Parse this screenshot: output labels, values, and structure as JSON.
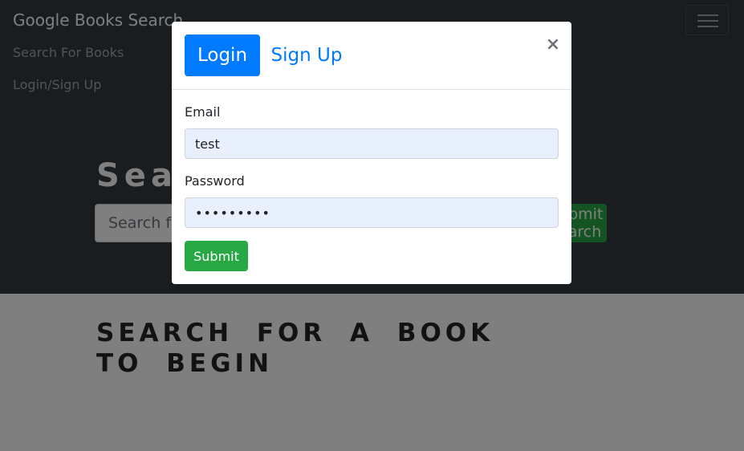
{
  "navbar": {
    "brand": "Google Books Search",
    "links": [
      "Search For Books",
      "Login/Sign Up"
    ]
  },
  "hero": {
    "title": "Search for Books!",
    "search_placeholder": "Search for a book",
    "search_button": "Submit Search"
  },
  "results": {
    "message": "Search for a book to begin"
  },
  "modal": {
    "tabs": {
      "login": "Login",
      "signup": "Sign Up"
    },
    "close_symbol": "×",
    "email_label": "Email",
    "email_value": "test",
    "password_label": "Password",
    "password_value": "password1",
    "submit_label": "Submit"
  },
  "colors": {
    "navbar_bg": "#343a40",
    "primary": "#007bff",
    "success": "#28a745",
    "autofill_bg": "#e8f0fe"
  }
}
